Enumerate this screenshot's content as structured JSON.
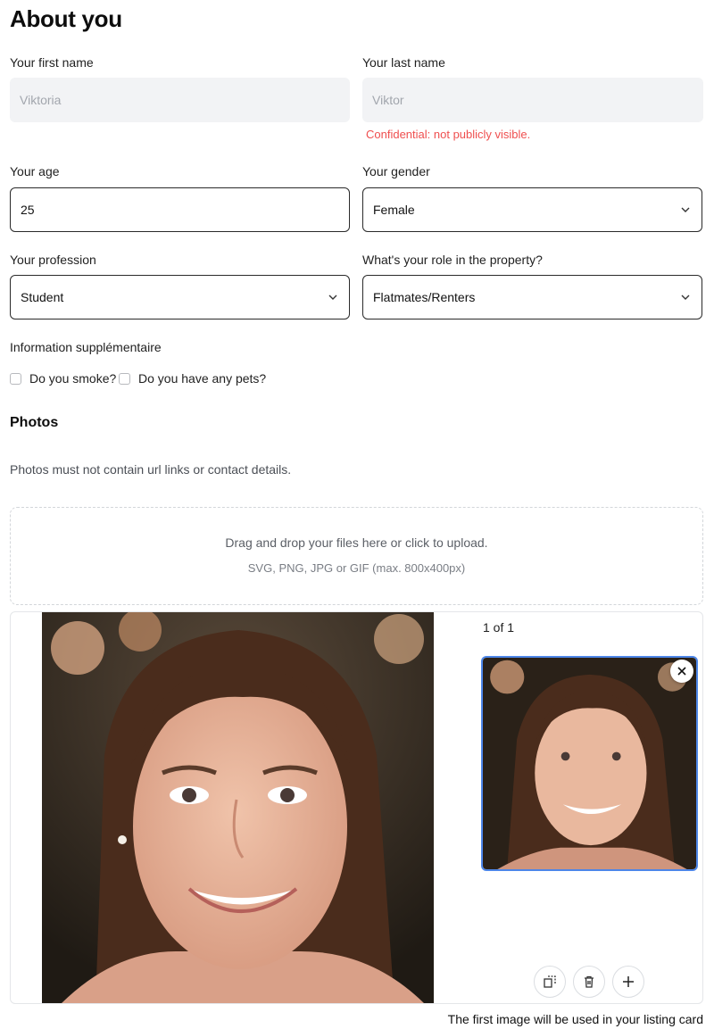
{
  "page": {
    "title": "About you"
  },
  "form": {
    "first_name": {
      "label": "Your first name",
      "value": "Viktoria"
    },
    "last_name": {
      "label": "Your last name",
      "value": "Viktor",
      "note": "Confidential: not publicly visible."
    },
    "age": {
      "label": "Your age",
      "value": "25"
    },
    "gender": {
      "label": "Your gender",
      "value": "Female"
    },
    "profession": {
      "label": "Your profession",
      "value": "Student"
    },
    "role": {
      "label": "What's your role in the property?",
      "value": "Flatmates/Renters"
    },
    "extra": {
      "label": "Information supplémentaire",
      "smoke_label": "Do you smoke?",
      "pets_label": "Do you have any pets?",
      "smoke_checked": false,
      "pets_checked": false
    }
  },
  "photos": {
    "title": "Photos",
    "hint": "Photos must not contain url links or contact details.",
    "dropzone_line1": "Drag and drop your files here or click to upload.",
    "dropzone_line2": "SVG, PNG, JPG or GIF (max. 800x400px)",
    "counter": "1 of 1",
    "footer_note": "The first image will be used in your listing card"
  },
  "colors": {
    "error": "#ef4f4f",
    "selected_border": "#4d86e8",
    "disabled_bg": "#f2f3f5"
  },
  "icons": {
    "select": "chevron-down-icon",
    "remove": "close-icon",
    "crop": "crop-icon",
    "delete": "trash-icon",
    "add": "plus-icon"
  }
}
